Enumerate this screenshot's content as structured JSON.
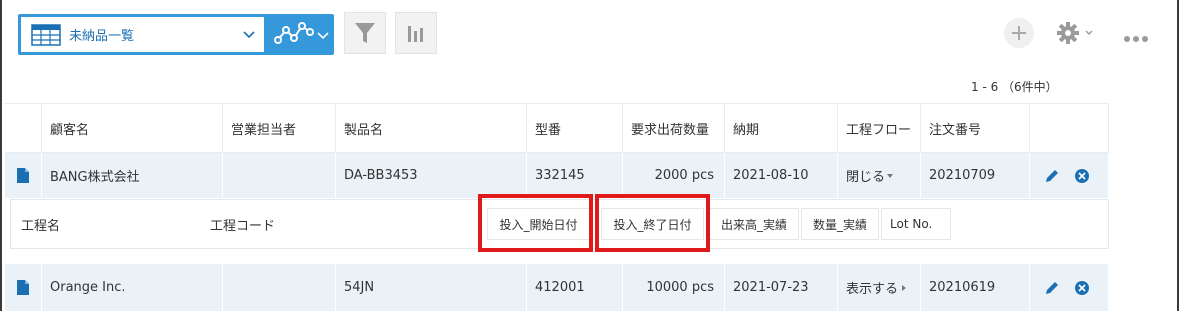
{
  "toolbar": {
    "view_name": "未納品一覧",
    "colors": {
      "accent": "#3498db",
      "icon_gray": "#9a9a9a"
    }
  },
  "pager": {
    "text": "1 - 6 （6件中）"
  },
  "table": {
    "headers": [
      "顧客名",
      "営業担当者",
      "製品名",
      "型番",
      "要求出荷数量",
      "納期",
      "工程フロー",
      "注文番号"
    ],
    "rows": [
      {
        "customer": "BANG株式会社",
        "sales_rep": "",
        "product": "DA-BB3453",
        "model": "332145",
        "qty": "2000 pcs",
        "due": "2021-08-10",
        "flow": "閉じる",
        "order_no": "20210709"
      },
      {
        "customer": "Orange Inc.",
        "sales_rep": "",
        "product": "54JN",
        "model": "412001",
        "qty": "10000 pcs",
        "due": "2021-07-23",
        "flow": "表示する",
        "order_no": "20210619"
      }
    ],
    "subtable_headers": [
      "工程名",
      "工程コード",
      "投入_開始日付",
      "投入_終了日付",
      "出来高_実績",
      "数量_実績",
      "Lot No."
    ]
  }
}
